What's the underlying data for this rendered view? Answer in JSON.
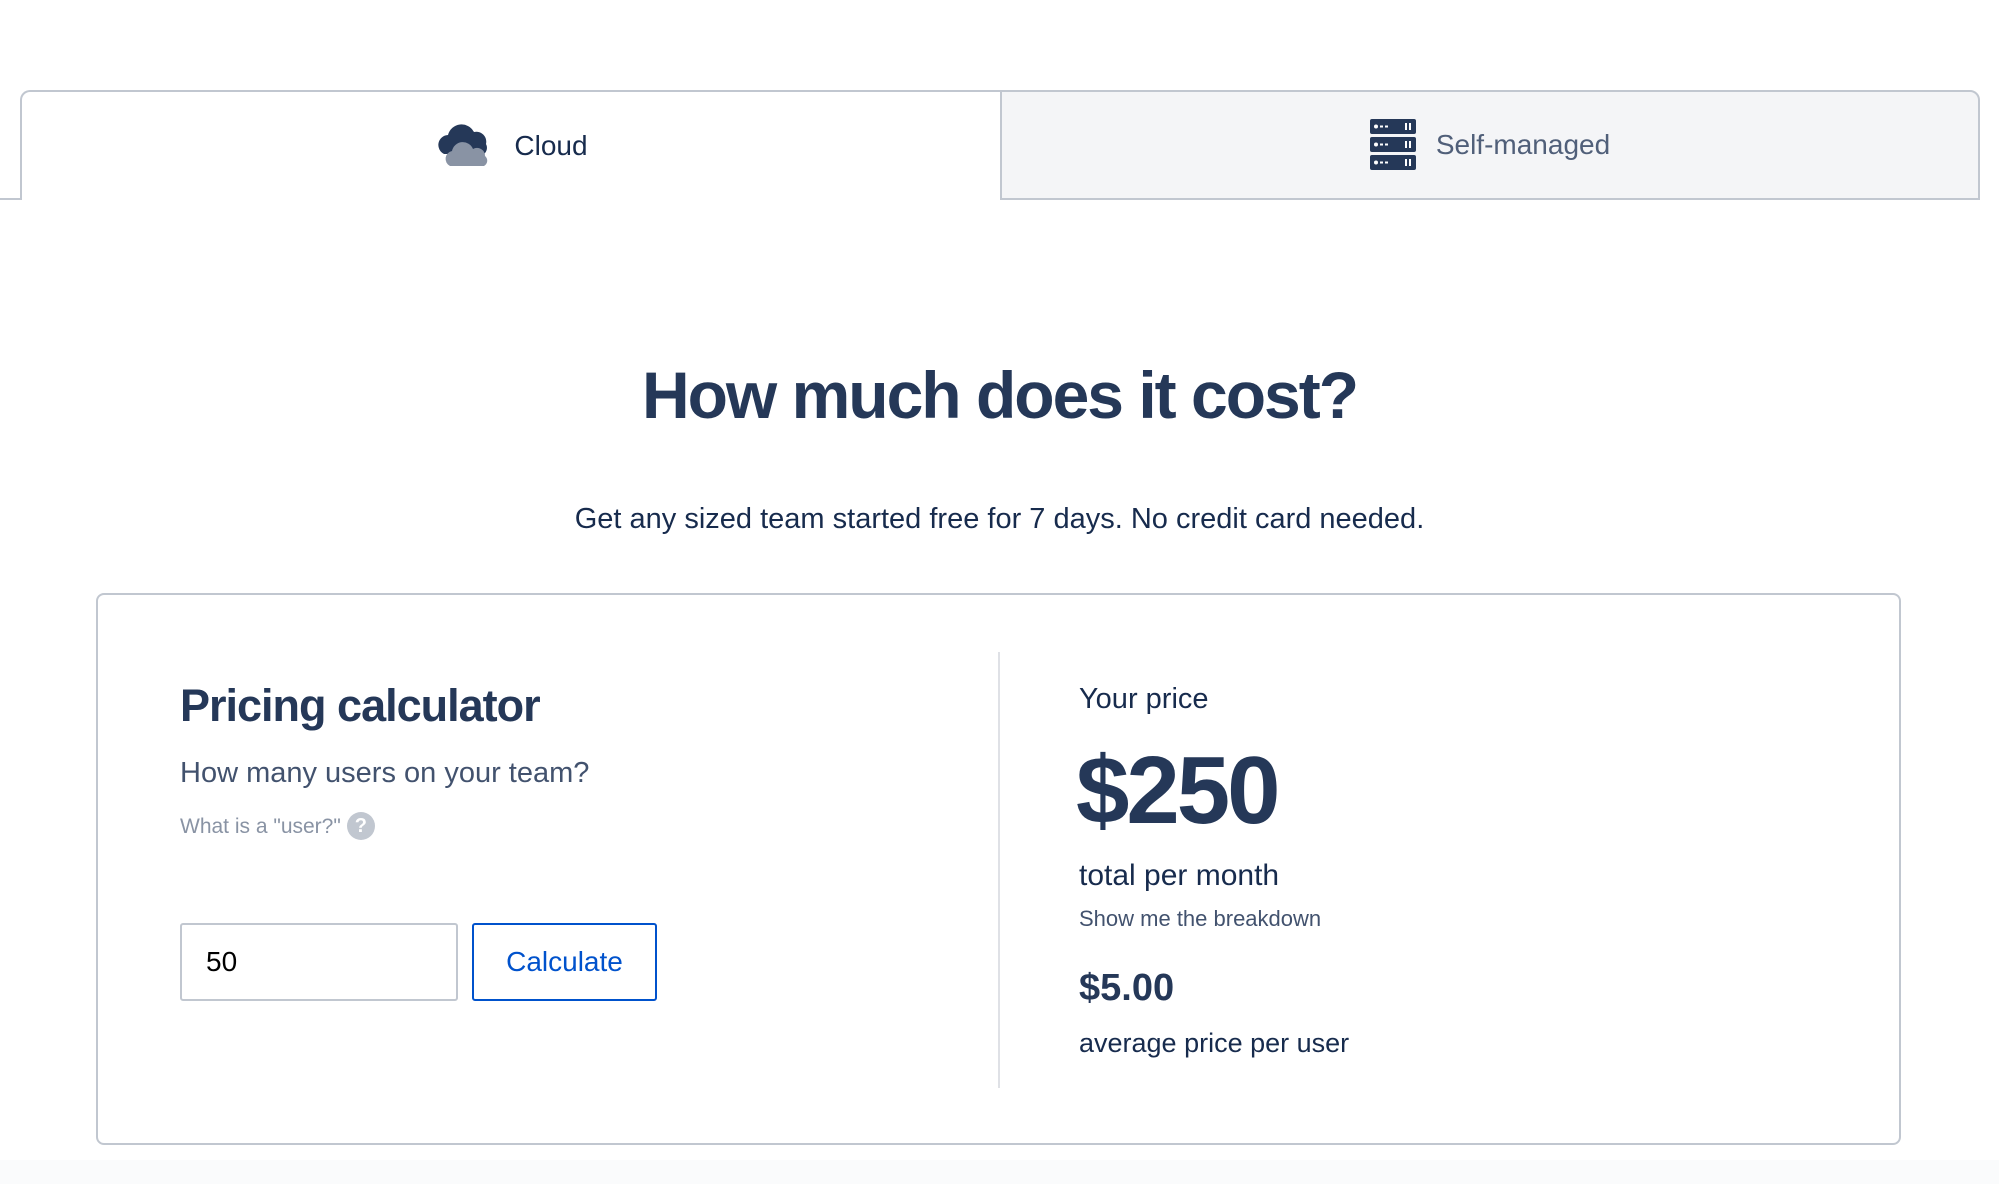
{
  "tabs": [
    {
      "label": "Cloud",
      "icon": "cloud-icon",
      "active": true
    },
    {
      "label": "Self-managed",
      "icon": "server-icon",
      "active": false
    }
  ],
  "hero": {
    "title": "How much does it cost?",
    "subtitle": "Get any sized team started free for 7 days. No credit card needed."
  },
  "calculator": {
    "title": "Pricing calculator",
    "question": "How many users on your team?",
    "help_text": "What is a \"user?\"",
    "help_icon": "question-circle-icon",
    "input_value": "50",
    "button_label": "Calculate"
  },
  "price": {
    "label": "Your price",
    "amount": "$250",
    "period": "total per month",
    "breakdown_link": "Show me the breakdown",
    "average": "$5.00",
    "average_label": "average price per user"
  },
  "colors": {
    "heading": "#253858",
    "text": "#172b4d",
    "muted": "#8993a4",
    "accent": "#0052cc",
    "border": "#c1c7d0",
    "inactive_tab_bg": "#f4f5f7"
  }
}
